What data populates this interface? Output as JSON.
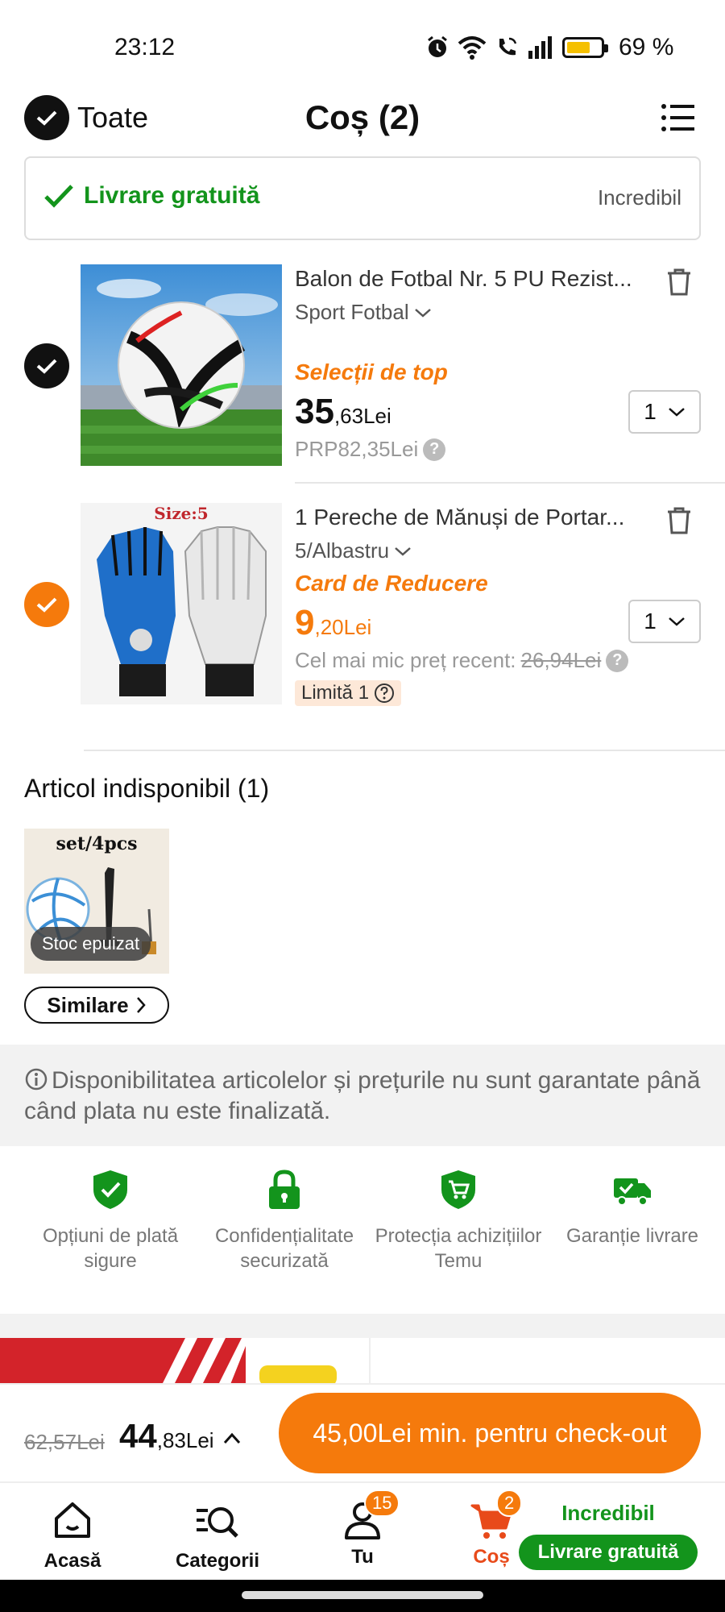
{
  "status_bar": {
    "time": "23:12",
    "battery_text": "69 %",
    "battery_level_percent": 69
  },
  "header": {
    "select_all_label": "Toate",
    "title": "Coș (2)"
  },
  "shipping": {
    "label": "Livrare gratuită",
    "badge": "Incredibil"
  },
  "items": [
    {
      "title": "Balon de Fotbal Nr. 5 PU Rezist...",
      "variant": "Sport Fotbal",
      "tag": "Selecții de top",
      "price_int": "35",
      "price_dec": ",63Lei",
      "sub": "PRP82,35Lei",
      "quantity": "1",
      "checked": true,
      "check_color": "#111111"
    },
    {
      "title": "1 Pereche de Mănuși de Portar...",
      "variant": "5/Albastru",
      "tag": "Card de Reducere",
      "price_int": "9",
      "price_dec": ",20Lei",
      "sub_label": "Cel mai mic preț recent:",
      "sub_strike": "26,94Lei",
      "limit": "Limită 1",
      "image_label": "Size:5",
      "quantity": "1",
      "checked": true,
      "check_color": "#f57a0c"
    }
  ],
  "unavailable": {
    "title": "Articol indisponibil (1)",
    "image_label": "set/4pcs",
    "stock_badge": "Stoc epuizat",
    "similar_label": "Similare"
  },
  "notice": "Disponibilitatea articolelor și prețurile nu sunt garantate până când plata nu este finalizată.",
  "guarantees": [
    {
      "label": "Opțiuni de plată sigure",
      "icon": "shield-check-icon"
    },
    {
      "label": "Confidențialitate securizată",
      "icon": "lock-icon"
    },
    {
      "label": "Protecția achizițiilor Temu",
      "icon": "shield-cart-icon"
    },
    {
      "label": "Garanție livrare",
      "icon": "truck-check-icon"
    }
  ],
  "checkout": {
    "old_total": "62,57Lei",
    "total_int": "44",
    "total_dec": ",83Lei",
    "button_label": "45,00Lei min. pentru check-out"
  },
  "nav": {
    "home": "Acasă",
    "categories": "Categorii",
    "you": "Tu",
    "you_badge": "15",
    "cart": "Coș",
    "cart_badge": "2",
    "promo_top": "Incredibil",
    "promo_pill": "Livrare gratuită"
  },
  "colors": {
    "accent": "#f57a0c",
    "green": "#13941c",
    "active_nav": "#e84a1a"
  }
}
